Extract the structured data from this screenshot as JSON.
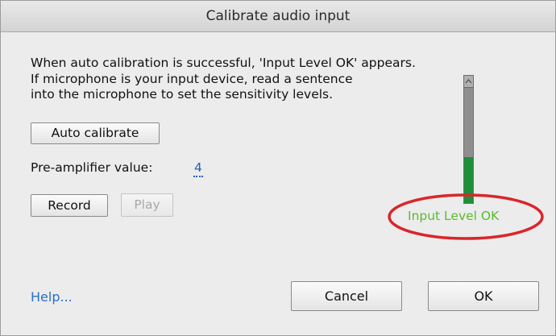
{
  "window": {
    "title": "Calibrate audio input"
  },
  "description": {
    "lines": [
      "When auto calibration is successful, 'Input Level OK' appears.",
      "If microphone is your input device, read a sentence",
      "into the microphone to set the sensitivity levels."
    ]
  },
  "controls": {
    "auto_calibrate_label": "Auto calibrate",
    "preamp_label": "Pre-amplifier value:",
    "preamp_value": "4",
    "record_label": "Record",
    "play_label": "Play"
  },
  "meter": {
    "level_fraction": 0.36,
    "fill_color": "#1f8f3a"
  },
  "status": {
    "text": "Input Level OK",
    "color": "#5bbb2c",
    "highlight_color": "#d9262a"
  },
  "footer": {
    "help_label": "Help...",
    "cancel_label": "Cancel",
    "ok_label": "OK"
  }
}
